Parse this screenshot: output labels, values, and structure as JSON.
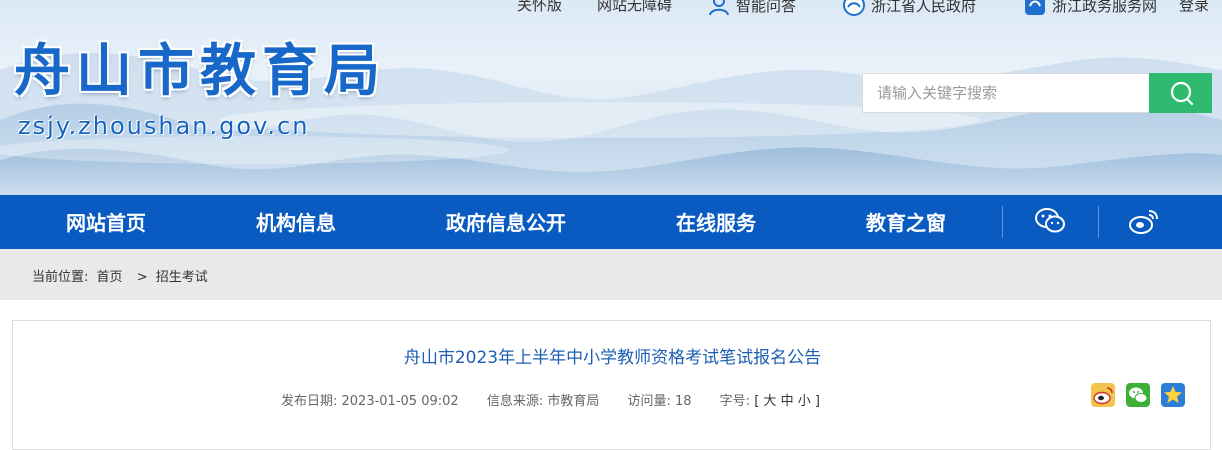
{
  "header": {
    "top_links": [
      {
        "label": "关怀版"
      },
      {
        "label": "网站无障碍"
      },
      {
        "label": "智能问答",
        "icon": "person-icon"
      },
      {
        "label": "浙江省人民政府",
        "icon": "gov-emblem-icon"
      },
      {
        "label": "浙江政务服务网",
        "icon": "service-app-icon"
      },
      {
        "label": "登录"
      }
    ],
    "logo_title": "舟山市教育局",
    "logo_domain": "zsjy.zhoushan.gov.cn",
    "search": {
      "placeholder": "请输入关键字搜索",
      "value": "",
      "button_icon": "search-icon"
    }
  },
  "nav": {
    "items": [
      {
        "label": "网站首页"
      },
      {
        "label": "机构信息"
      },
      {
        "label": "政府信息公开"
      },
      {
        "label": "在线服务"
      },
      {
        "label": "教育之窗"
      }
    ],
    "icons": [
      "wechat-icon",
      "weibo-icon"
    ]
  },
  "breadcrumb": {
    "prefix": "当前位置:",
    "items": [
      "首页",
      "招生考试"
    ],
    "separator": ">"
  },
  "article": {
    "title": "舟山市2023年上半年中小学教师资格考试笔试报名公告",
    "publish_date": "发布日期: 2023-01-05 09:02",
    "source": "信息来源: 市教育局",
    "views": "访问量: 18",
    "font_size_label": "字号:",
    "font_sizes": [
      "[",
      "大",
      "中",
      "小",
      "]"
    ],
    "share_icons": [
      "weibo-share-icon",
      "wechat-share-icon",
      "favorite-star-icon"
    ]
  },
  "colors": {
    "nav_blue": "#0a5bc1",
    "search_green": "#2ebb6f",
    "title_blue": "#1d5fb4",
    "logo_blue": "#1768c8"
  }
}
